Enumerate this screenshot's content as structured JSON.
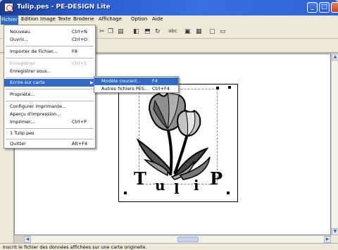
{
  "window": {
    "title": "Tulip.pes - PE-DESIGN Lite"
  },
  "menubar": [
    "Fichier",
    "Edition",
    "Image",
    "Texte",
    "Broderie",
    "Affichage",
    "Option",
    "Aide"
  ],
  "file_menu": [
    {
      "label": "Nouveau",
      "shortcut": "Ctrl+N"
    },
    {
      "label": "Ouvrir...",
      "shortcut": "Ctrl+O"
    },
    {
      "label": "Importer de Fichier...",
      "shortcut": "F8"
    },
    {
      "label": "Enregistrer",
      "shortcut": "Ctrl+S",
      "disabled": true
    },
    {
      "label": "Enregistrer sous...",
      "shortcut": ""
    },
    {
      "label": "Ecrire sur carte",
      "shortcut": ""
    },
    {
      "label": "Propriété...",
      "shortcut": ""
    },
    {
      "label": "Configurer imprimante...",
      "shortcut": ""
    },
    {
      "label": "Aperçu d'impression...",
      "shortcut": ""
    },
    {
      "label": "Imprimer...",
      "shortcut": "Ctrl+P"
    },
    {
      "label": "1 Tulip.pes",
      "shortcut": ""
    },
    {
      "label": "Quitter",
      "shortcut": "Alt+F4"
    }
  ],
  "submenu": [
    {
      "label": "Modèle courant...",
      "shortcut": "F4"
    },
    {
      "label": "Autres fichiers PES...",
      "shortcut": "Ctrl+F4"
    }
  ],
  "design": {
    "letters": [
      "T",
      "u",
      "l",
      "i",
      "P"
    ]
  },
  "status": "Inscrit le fichier des données affichées sur une carte originelle.",
  "toolbar_icons": [
    "cut-icon",
    "copy-icon",
    "paste-icon",
    "mirror-icon",
    "flip-icon",
    "rotate-icon",
    "spellcheck-icon",
    "layout-icon",
    "grid-icon",
    "preview-icon",
    "zoom-icon"
  ]
}
